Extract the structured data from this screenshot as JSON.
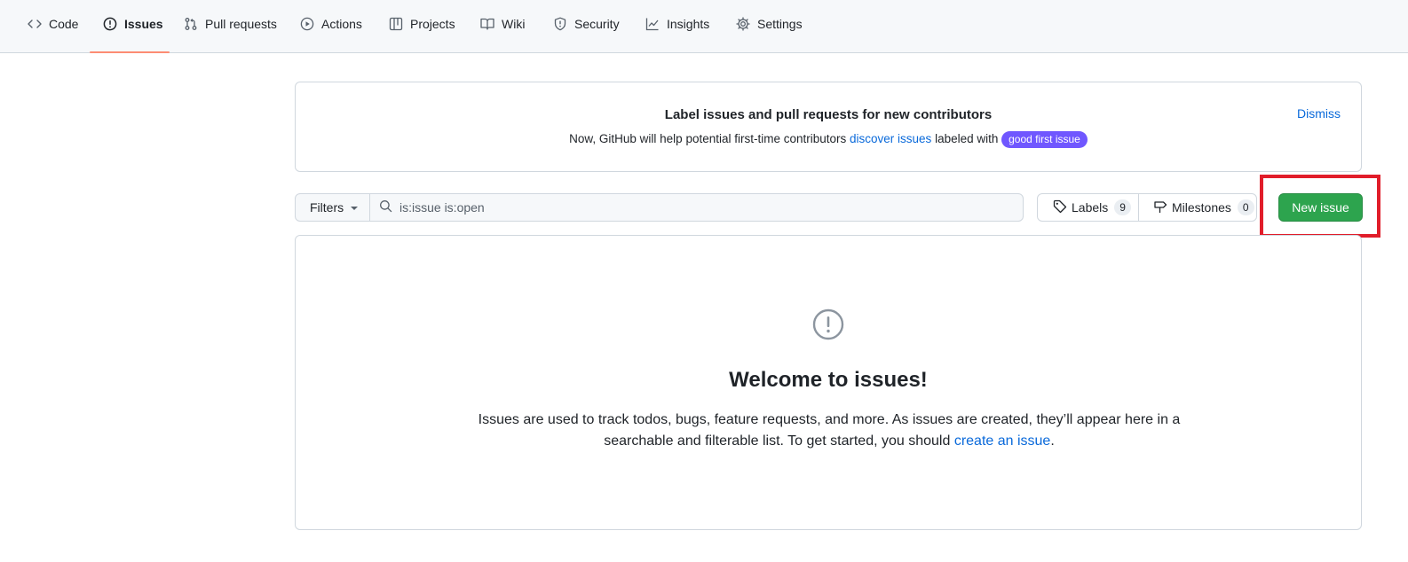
{
  "nav": {
    "tabs": [
      {
        "label": "Code",
        "icon": "code-icon"
      },
      {
        "label": "Issues",
        "icon": "issue-opened-icon",
        "selected": true
      },
      {
        "label": "Pull requests",
        "icon": "git-pull-request-icon"
      },
      {
        "label": "Actions",
        "icon": "play-icon"
      },
      {
        "label": "Projects",
        "icon": "table-icon"
      },
      {
        "label": "Wiki",
        "icon": "book-icon"
      },
      {
        "label": "Security",
        "icon": "shield-icon"
      },
      {
        "label": "Insights",
        "icon": "graph-icon"
      },
      {
        "label": "Settings",
        "icon": "gear-icon"
      }
    ],
    "selected_underline_color": "#fd8c73"
  },
  "banner": {
    "title": "Label issues and pull requests for new contributors",
    "text_before": "Now, GitHub will help potential first-time contributors ",
    "link": "discover issues",
    "text_after": " labeled with ",
    "badge": "good first issue",
    "badge_color": "#7057ff",
    "dismiss": "Dismiss"
  },
  "toolbar": {
    "filters_label": "Filters",
    "search_value": "is:issue is:open",
    "labels_label": "Labels",
    "labels_count": "9",
    "milestones_label": "Milestones",
    "milestones_count": "0",
    "new_issue_label": "New issue",
    "new_issue_color": "#2da44e",
    "highlight_color": "#e11d2a"
  },
  "blankslate": {
    "icon": "issue-opened-icon",
    "title": "Welcome to issues!",
    "desc_before": "Issues are used to track todos, bugs, feature requests, and more. As issues are created, they’ll appear here in a searchable and filterable list. To get started, you should ",
    "link": "create an issue",
    "desc_after": "."
  }
}
